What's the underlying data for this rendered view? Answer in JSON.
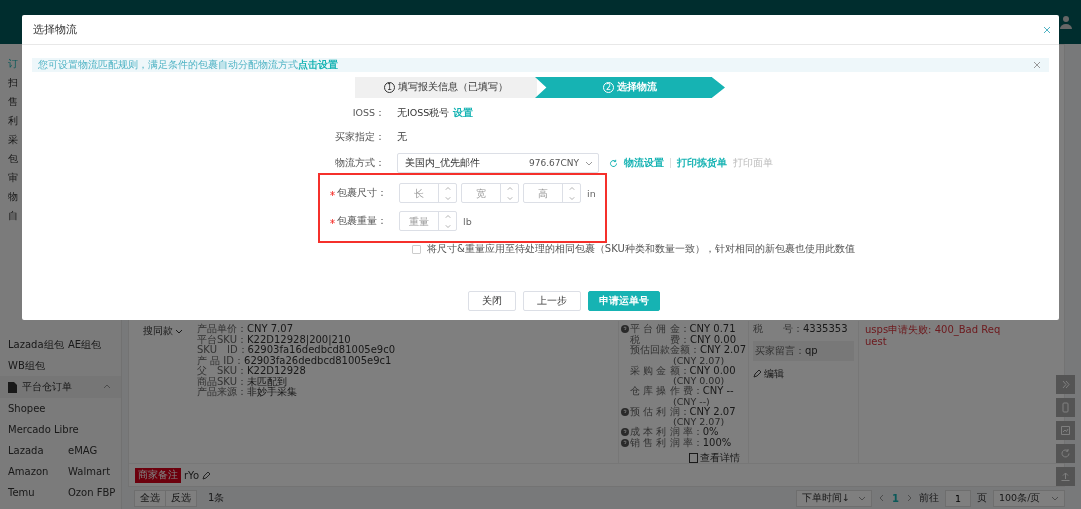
{
  "background": {
    "sidebar": {
      "cut_items": [
        {
          "label": "订",
          "selected": true
        },
        {
          "label": "扫",
          "selected": false
        },
        {
          "label": "售",
          "selected": false
        },
        {
          "label": "利",
          "selected": false
        },
        {
          "label": "采",
          "selected": false
        },
        {
          "label": "包",
          "selected": false
        },
        {
          "label": "审",
          "selected": false
        },
        {
          "label": "物",
          "selected": false
        },
        {
          "label": "自",
          "selected": false
        }
      ],
      "rows_top": [
        [
          "Lazada组包",
          "AE组包"
        ],
        [
          "WB组包"
        ]
      ],
      "section": {
        "label": "平台仓订单",
        "expanded": true
      },
      "rows_bottom": [
        [
          "Shopee"
        ],
        [
          "Mercado Libre"
        ],
        [
          "Lazada",
          "eMAG"
        ],
        [
          "Amazon",
          "Walmart"
        ],
        [
          "Temu",
          "Ozon FBP"
        ]
      ]
    },
    "product": {
      "button": "搜同款",
      "details": [
        {
          "label": "产品单价：",
          "value": "CNY 7.07"
        },
        {
          "label": "平台SKU：",
          "value": "K22D12928|200|210"
        },
        {
          "label": "SKU　ID：",
          "value": "62903fa16dedbcd81005e9c0"
        },
        {
          "label": "产 品 ID：",
          "value": "62903fa26dedbcd81005e9c1"
        },
        {
          "label": "父　SKU：",
          "value": "K22D12928"
        },
        {
          "label": "商品SKU：",
          "value": "未匹配到"
        },
        {
          "label": "产品来源：",
          "value": "非妙手采集"
        }
      ]
    },
    "fees": [
      {
        "label": "平 台 佣 金：",
        "value": "CNY 0.71",
        "help": true
      },
      {
        "label": "税　　　费：",
        "value": "CNY 0.00",
        "help": false
      },
      {
        "label": "预估回款金额：",
        "value": "CNY 2.07",
        "help": false,
        "note": "(CNY 2.07)"
      },
      {
        "label": "采 购 金 额：",
        "value": "CNY 0.00",
        "help": false,
        "note": "(CNY 0.00)"
      },
      {
        "label": "仓 库 操 作 费：",
        "value": "CNY --",
        "help": false,
        "note": "(CNY --)"
      },
      {
        "label": "预 估 利 润：",
        "value": "CNY 2.07",
        "help": true,
        "note": "(CNY 2.07)"
      },
      {
        "label": "成 本 利 润 率：",
        "value": "0%",
        "help": true
      },
      {
        "label": "销 售 利 润 率：",
        "value": "100%",
        "help": true
      }
    ],
    "details_link": "查看详情",
    "address": {
      "tax": {
        "label": "税　　号：",
        "value": "4335353"
      },
      "message": {
        "label": "买家留言：",
        "value": "qp"
      },
      "edit": "编辑"
    },
    "error": "usps申请失败: 400_Bad Request",
    "remark": {
      "tag": "商家备注",
      "text": "rYo"
    },
    "bottom_bar": {
      "buttons": [
        "全选",
        "反选"
      ],
      "count": "1条",
      "sort": "下单时间↓",
      "pages": [
        {
          "label": "1",
          "selected": true
        }
      ],
      "goto_label": "前往",
      "goto_value": "1",
      "page_unit": "页",
      "page_size": "100条/页"
    }
  },
  "dialog": {
    "title": "选择物流",
    "alert": {
      "text": "您可设置物流匹配规则，满足条件的包裹自动分配物流方式",
      "link": "点击设置"
    },
    "steps": [
      {
        "number": "1",
        "label": "填写报关信息（已填写）",
        "selected": false
      },
      {
        "number": "2",
        "label": "选择物流",
        "selected": true
      }
    ],
    "ioss": {
      "label": "IOSS：",
      "value": "无IOSS税号",
      "link": "设置"
    },
    "buyer": {
      "label": "买家指定：",
      "value": "无"
    },
    "shipping": {
      "label": "物流方式：",
      "value": "美国内_优先邮件",
      "price": "976.67CNY",
      "links": [
        {
          "label": "物流设置",
          "disabled": false
        },
        {
          "label": "打印拣货单",
          "disabled": false
        },
        {
          "label": "打印面单",
          "disabled": true
        }
      ]
    },
    "size": {
      "label": "包裹尺寸：",
      "required": true,
      "inputs": [
        {
          "placeholder": "长"
        },
        {
          "placeholder": "宽"
        },
        {
          "placeholder": "高"
        }
      ],
      "unit": "in"
    },
    "weight": {
      "label": "包裹重量：",
      "required": true,
      "inputs": [
        {
          "placeholder": "重量"
        }
      ],
      "unit": "lb"
    },
    "apply_same": {
      "label": "将尺寸&重量应用至待处理的相同包裹（SKU种类和数量一致），针对相同的新包裹也使用此数值",
      "checked": false
    },
    "buttons": [
      {
        "label": "关闭",
        "kind": "default"
      },
      {
        "label": "上一步",
        "kind": "default"
      },
      {
        "label": "申请运单号",
        "kind": "primary"
      }
    ]
  }
}
